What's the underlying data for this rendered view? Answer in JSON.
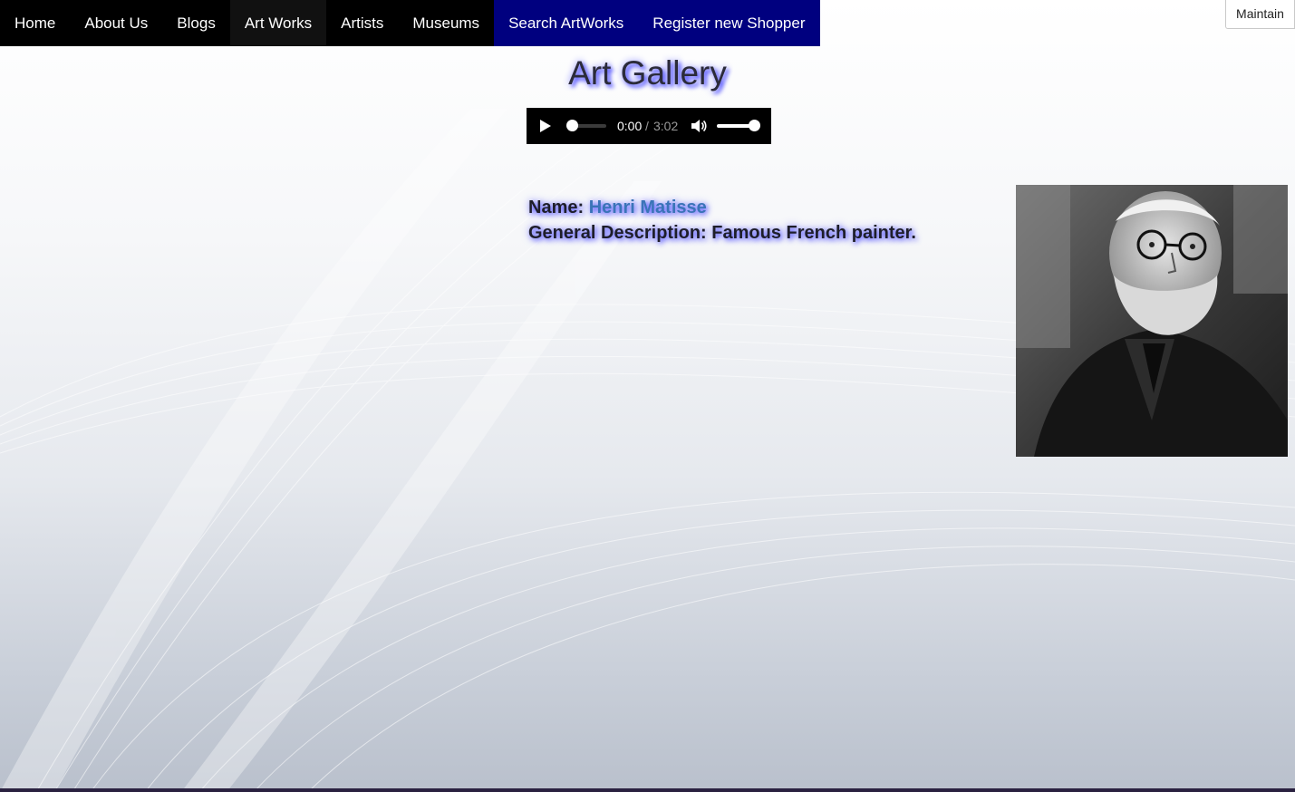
{
  "nav": {
    "items": [
      {
        "label": "Home"
      },
      {
        "label": "About Us"
      },
      {
        "label": "Blogs"
      },
      {
        "label": "Art Works"
      },
      {
        "label": "Artists"
      },
      {
        "label": "Museums"
      },
      {
        "label": "Search ArtWorks"
      },
      {
        "label": "Register new Shopper"
      }
    ]
  },
  "maintain_label": "Maintain",
  "page": {
    "title": "Art Gallery"
  },
  "audio": {
    "current_time": "0:00",
    "separator": "/",
    "duration": "3:02",
    "progress_fraction": 0,
    "volume_fraction": 1
  },
  "artist": {
    "name_label": "Name:",
    "name": "Henri Matisse",
    "description_label": "General Description:",
    "description": "Famous French painter."
  },
  "colors": {
    "nav_background": "#000000",
    "nav_active": "#111111",
    "nav_blue": "#00007f",
    "title_glow": "#4d4dff",
    "name_link": "#3a74b8"
  },
  "icons": {
    "play": "play-icon",
    "volume": "volume-icon"
  }
}
